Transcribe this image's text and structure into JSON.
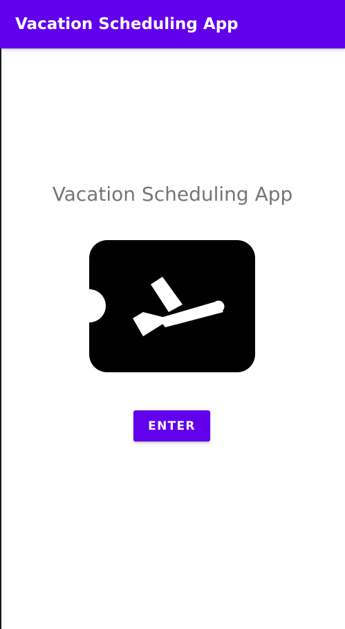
{
  "app_bar": {
    "title": "Vacation Scheduling App",
    "color": "#6200ee"
  },
  "main": {
    "headline": "Vacation Scheduling App",
    "headline_color": "#757575",
    "illustration": {
      "icon": "flight-ticket-icon",
      "color": "#000000"
    },
    "enter_button": {
      "label": "ENTER",
      "color": "#6200ee"
    }
  }
}
